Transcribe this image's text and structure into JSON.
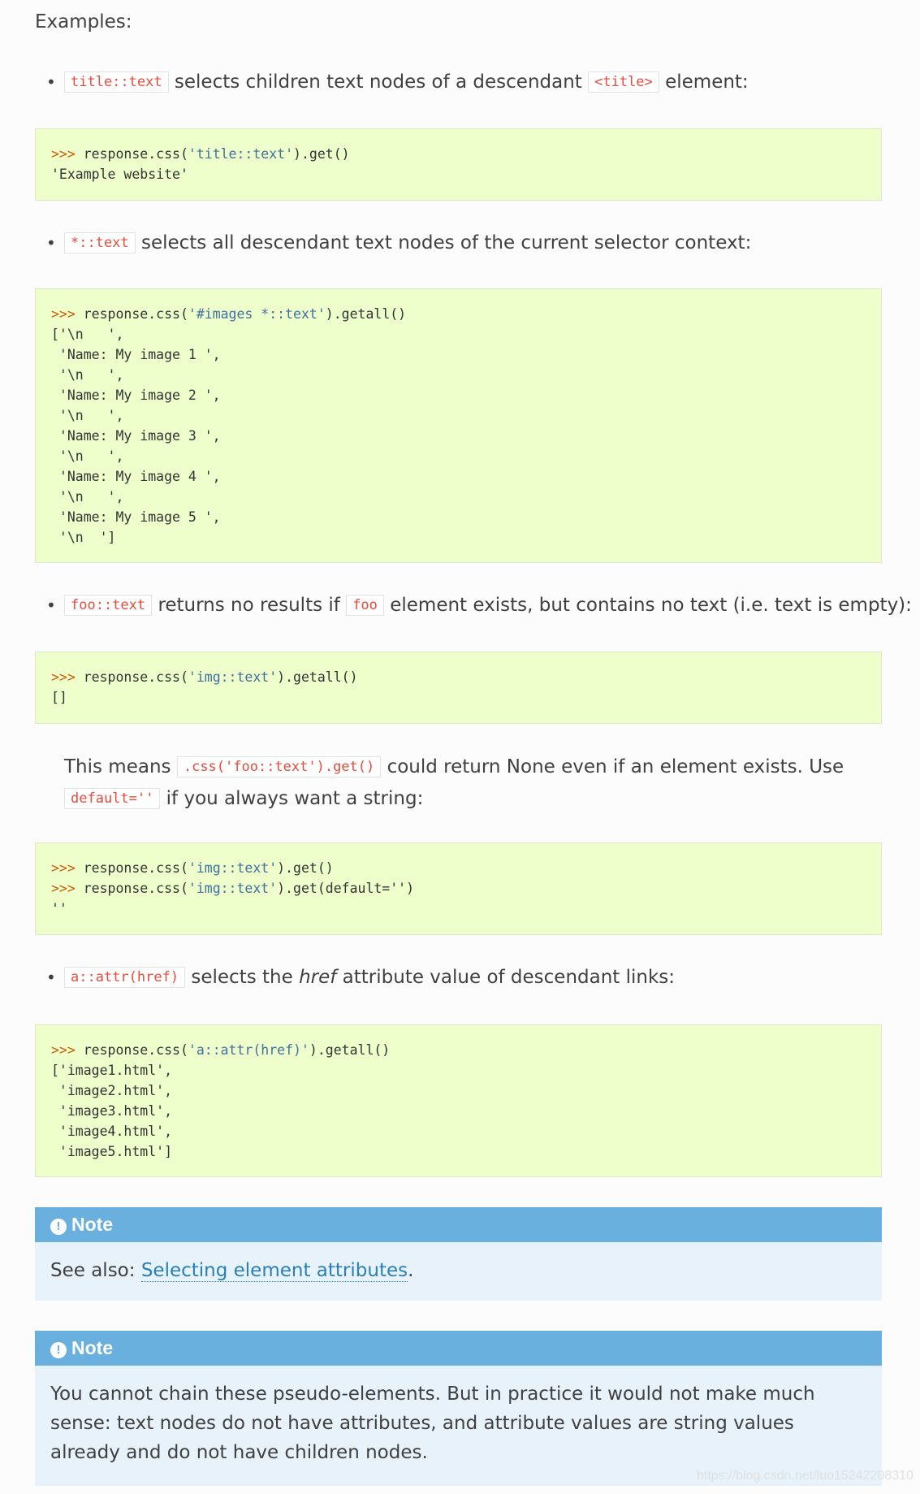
{
  "intro": "Examples:",
  "b1": {
    "code1": "title::text",
    "text1": "selects children text nodes of a descendant",
    "code2": "<title>",
    "text2": "element:"
  },
  "code1": {
    "prompt": ">>>",
    "pre": " response.css(",
    "str": "'title::text'",
    "post": ").get()",
    "output": "'Example website'"
  },
  "b2": {
    "code1": "*::text",
    "text1": "selects all descendant text nodes of the current selector context:"
  },
  "code2": {
    "prompt": ">>>",
    "pre": " response.css(",
    "str": "'#images *::text'",
    "post": ").getall()",
    "output": "['\\n   ',\n 'Name: My image 1 ',\n '\\n   ',\n 'Name: My image 2 ',\n '\\n   ',\n 'Name: My image 3 ',\n '\\n   ',\n 'Name: My image 4 ',\n '\\n   ',\n 'Name: My image 5 ',\n '\\n  ']"
  },
  "b3": {
    "code1": "foo::text",
    "text1": "returns no results if",
    "code2": "foo",
    "text2": "element exists, but contains no text (i.e. text is empty):"
  },
  "code3": {
    "prompt": ">>>",
    "pre": " response.css(",
    "str": "'img::text'",
    "post": ").getall()",
    "output": "[]"
  },
  "para": {
    "t1": "This means",
    "code1": ".css('foo::text').get()",
    "t2": "could return None even if an element exists. Use",
    "code2": "default=''",
    "t3": "if you always want a string:"
  },
  "code4": {
    "prompt": ">>>",
    "pre1": " response.css(",
    "str1": "'img::text'",
    "post1": ").get()",
    "pre2": " response.css(",
    "str2": "'img::text'",
    "post2": ").get(default='')",
    "output": "''"
  },
  "b4": {
    "code1": "a::attr(href)",
    "text1": "selects the",
    "em": "href",
    "text2": "attribute value of descendant links:"
  },
  "code5": {
    "prompt": ">>>",
    "pre": " response.css(",
    "str": "'a::attr(href)'",
    "post": ").getall()",
    "output": "['image1.html',\n 'image2.html',\n 'image3.html',\n 'image4.html',\n 'image5.html']"
  },
  "note1": {
    "title": "Note",
    "text": "See also:",
    "link": "Selecting element attributes",
    "end": "."
  },
  "note2": {
    "title": "Note",
    "text": "You cannot chain these pseudo-elements. But in practice it would not make much sense: text nodes do not have attributes, and attribute values are string values already and do not have children nodes."
  },
  "watermark": "https://blog.csdn.net/luo15242208310"
}
